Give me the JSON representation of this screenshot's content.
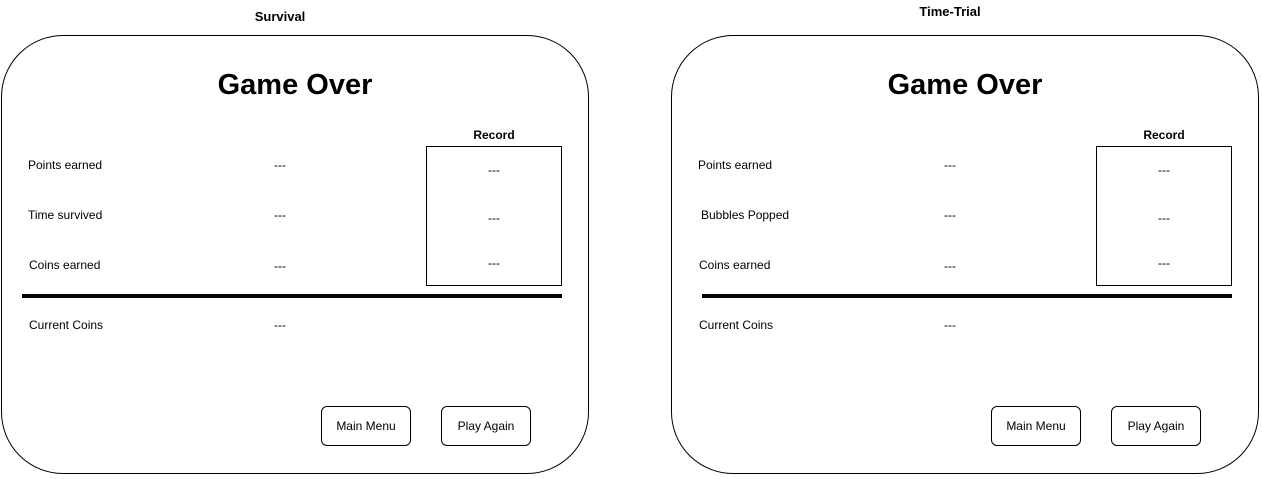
{
  "screens": [
    {
      "mode": "Survival",
      "title": "Game Over",
      "record_title": "Record",
      "stats": [
        {
          "label": "Points earned",
          "value": "---",
          "record": "---"
        },
        {
          "label": "Time survived",
          "value": "---",
          "record": "---"
        },
        {
          "label": "Coins earned",
          "value": "---",
          "record": "---"
        }
      ],
      "current_coins": {
        "label": "Current Coins",
        "value": "---"
      },
      "buttons": {
        "main_menu": "Main Menu",
        "play_again": "Play Again"
      }
    },
    {
      "mode": "Time-Trial",
      "title": "Game Over",
      "record_title": "Record",
      "stats": [
        {
          "label": "Points earned",
          "value": "---",
          "record": "---"
        },
        {
          "label": "Bubbles Popped",
          "value": "---",
          "record": "---"
        },
        {
          "label": "Coins earned",
          "value": "---",
          "record": "---"
        }
      ],
      "current_coins": {
        "label": "Current Coins",
        "value": "---"
      },
      "buttons": {
        "main_menu": "Main Menu",
        "play_again": "Play Again"
      }
    }
  ]
}
